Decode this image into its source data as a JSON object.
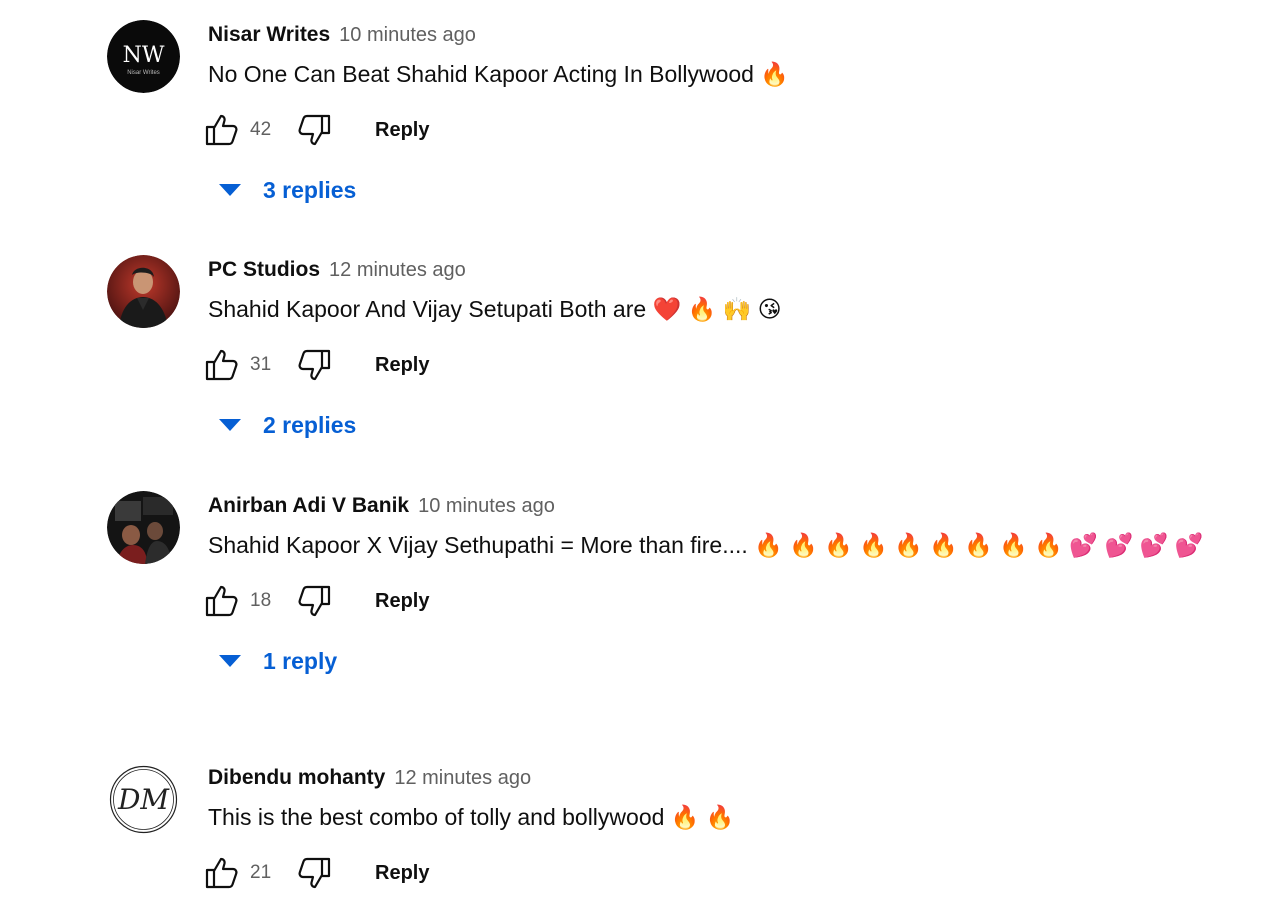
{
  "comments": [
    {
      "author": "Nisar Writes",
      "time": "10 minutes ago",
      "text": "No One Can Beat Shahid Kapoor Acting In Bollywood 🔥",
      "likes": "42",
      "reply_label": "Reply",
      "replies_label": "3 replies",
      "avatar_text": "NW",
      "avatar_subtext": "Nisar Writes"
    },
    {
      "author": "PC Studios",
      "time": "12 minutes ago",
      "text": "Shahid Kapoor And Vijay Setupati Both are ❤️ 🔥 🙌 😘",
      "likes": "31",
      "reply_label": "Reply",
      "replies_label": "2 replies"
    },
    {
      "author": "Anirban Adi V Banik",
      "time": "10 minutes ago",
      "text": "Shahid Kapoor X Vijay Sethupathi = More than fire.... 🔥 🔥 🔥 🔥 🔥 🔥 🔥 🔥 🔥 💕 💕 💕 💕",
      "likes": "18",
      "reply_label": "Reply",
      "replies_label": "1 reply"
    },
    {
      "author": "Dibendu mohanty",
      "time": "12 minutes ago",
      "text": "This is the best combo of tolly and bollywood 🔥 🔥",
      "likes": "21",
      "reply_label": "Reply",
      "avatar_text": "DM"
    }
  ],
  "colors": {
    "link_blue": "#065fd4",
    "secondary_text": "#606060",
    "primary_text": "#0f0f0f"
  },
  "icons": {
    "like": "thumb-up-outline",
    "dislike": "thumb-down-outline",
    "expand": "caret-down-filled"
  }
}
